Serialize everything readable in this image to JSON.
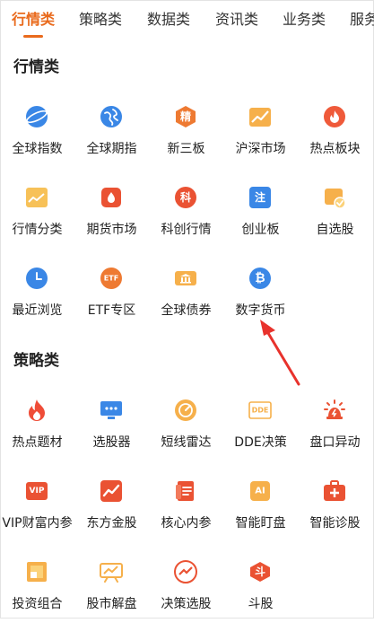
{
  "tabs": [
    "行情类",
    "策略类",
    "数据类",
    "资讯类",
    "业务类",
    "服务"
  ],
  "sections": [
    {
      "title": "行情类",
      "items": [
        {
          "label": "全球指数",
          "icon": "globe-icon"
        },
        {
          "label": "全球期指",
          "icon": "earth-icon"
        },
        {
          "label": "新三板",
          "icon": "jing-icon",
          "glyph": "精"
        },
        {
          "label": "沪深市场",
          "icon": "trend-chart-icon"
        },
        {
          "label": "热点板块",
          "icon": "flame-icon"
        },
        {
          "label": "行情分类",
          "icon": "line-chart-icon"
        },
        {
          "label": "期货市场",
          "icon": "drop-card-icon"
        },
        {
          "label": "科创行情",
          "icon": "ke-icon",
          "glyph": "科"
        },
        {
          "label": "创业板",
          "icon": "zhu-icon",
          "glyph": "注"
        },
        {
          "label": "自选股",
          "icon": "check-folder-icon"
        },
        {
          "label": "最近浏览",
          "icon": "clock-icon"
        },
        {
          "label": "ETF专区",
          "icon": "etf-icon",
          "glyph": "ETF"
        },
        {
          "label": "全球债券",
          "icon": "bank-ticket-icon"
        },
        {
          "label": "数字货币",
          "icon": "bitcoin-icon",
          "glyph": "₿"
        }
      ]
    },
    {
      "title": "策略类",
      "items": [
        {
          "label": "热点题材",
          "icon": "fire-icon"
        },
        {
          "label": "选股器",
          "icon": "monitor-icon"
        },
        {
          "label": "短线雷达",
          "icon": "radar-icon"
        },
        {
          "label": "DDE决策",
          "icon": "dde-icon",
          "glyph": "DDE"
        },
        {
          "label": "盘口异动",
          "icon": "alarm-icon"
        },
        {
          "label": "VIP财富内参",
          "icon": "vip-icon",
          "glyph": "VIP"
        },
        {
          "label": "东方金股",
          "icon": "rising-chart-icon"
        },
        {
          "label": "核心内参",
          "icon": "document-icon"
        },
        {
          "label": "智能盯盘",
          "icon": "ai-icon",
          "glyph": "AI"
        },
        {
          "label": "智能诊股",
          "icon": "medical-kit-icon"
        },
        {
          "label": "投资组合",
          "icon": "portfolio-icon"
        },
        {
          "label": "股市解盘",
          "icon": "board-icon"
        },
        {
          "label": "决策选股",
          "icon": "decision-chart-icon"
        },
        {
          "label": "斗股",
          "icon": "dou-icon",
          "glyph": "斗"
        }
      ]
    }
  ]
}
